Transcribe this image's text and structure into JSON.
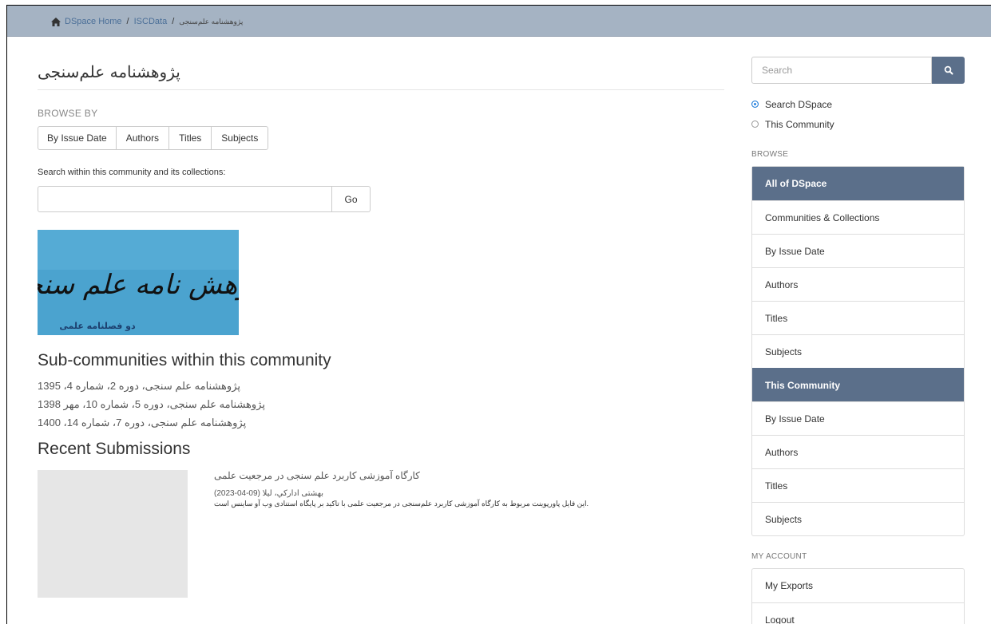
{
  "breadcrumb": {
    "home": "DSpace Home",
    "sep": "/",
    "second": "ISCData",
    "current": "پژوهشنامه علم‌سنجی"
  },
  "main": {
    "title": "پژوهشنامه علم‌سنجی",
    "browse_by": "BROWSE BY",
    "browse_buttons": [
      "By Issue Date",
      "Authors",
      "Titles",
      "Subjects"
    ],
    "search_label": "Search within this community and its collections:",
    "search_value": "",
    "go_label": "Go",
    "logo_title": "پژوهش نامه علم سنجی",
    "logo_subtitle": "دو فصلنامه علمی",
    "subcommunities_heading": "Sub-communities within this community",
    "subcommunities": [
      "پژوهشنامه علم سنجی، دوره 2، شماره 4، 1395",
      "پژوهشنامه علم سنجی، دوره 5، شماره 10، مهر 1398",
      "پژوهشنامه علم سنجی، دوره 7، شماره 14، 1400"
    ],
    "recent_heading": "Recent Submissions",
    "recent_item": {
      "title": "کارگاه آموزشی کاربرد علم سنجی در مرجعیت علمی",
      "meta": "بهشتی اداركي، لیلا (09-04-2023)",
      "abstract": ".این فایل پاورپوینت مربوط به کارگاه آموزشی کاربرد علم‌سنجی در مرجعیت علمی با تاکید بر پایگاه استنادی وب آو ساینس است"
    }
  },
  "sidebar": {
    "search_placeholder": "Search",
    "radio_options": [
      "Search DSpace",
      "This Community"
    ],
    "browse_title": "BROWSE",
    "all_of_dspace": "All of DSpace",
    "all_items": [
      "Communities & Collections",
      "By Issue Date",
      "Authors",
      "Titles",
      "Subjects"
    ],
    "this_community": "This Community",
    "community_items": [
      "By Issue Date",
      "Authors",
      "Titles",
      "Subjects"
    ],
    "account_title": "MY ACCOUNT",
    "account_items": [
      "My Exports",
      "Logout"
    ]
  },
  "colors": {
    "topbar": "#a5b3c3",
    "accent": "#5b6f8a",
    "logo_bg": "#4ba3cf"
  },
  "icons": {
    "home": "home-icon",
    "search": "search-icon"
  }
}
